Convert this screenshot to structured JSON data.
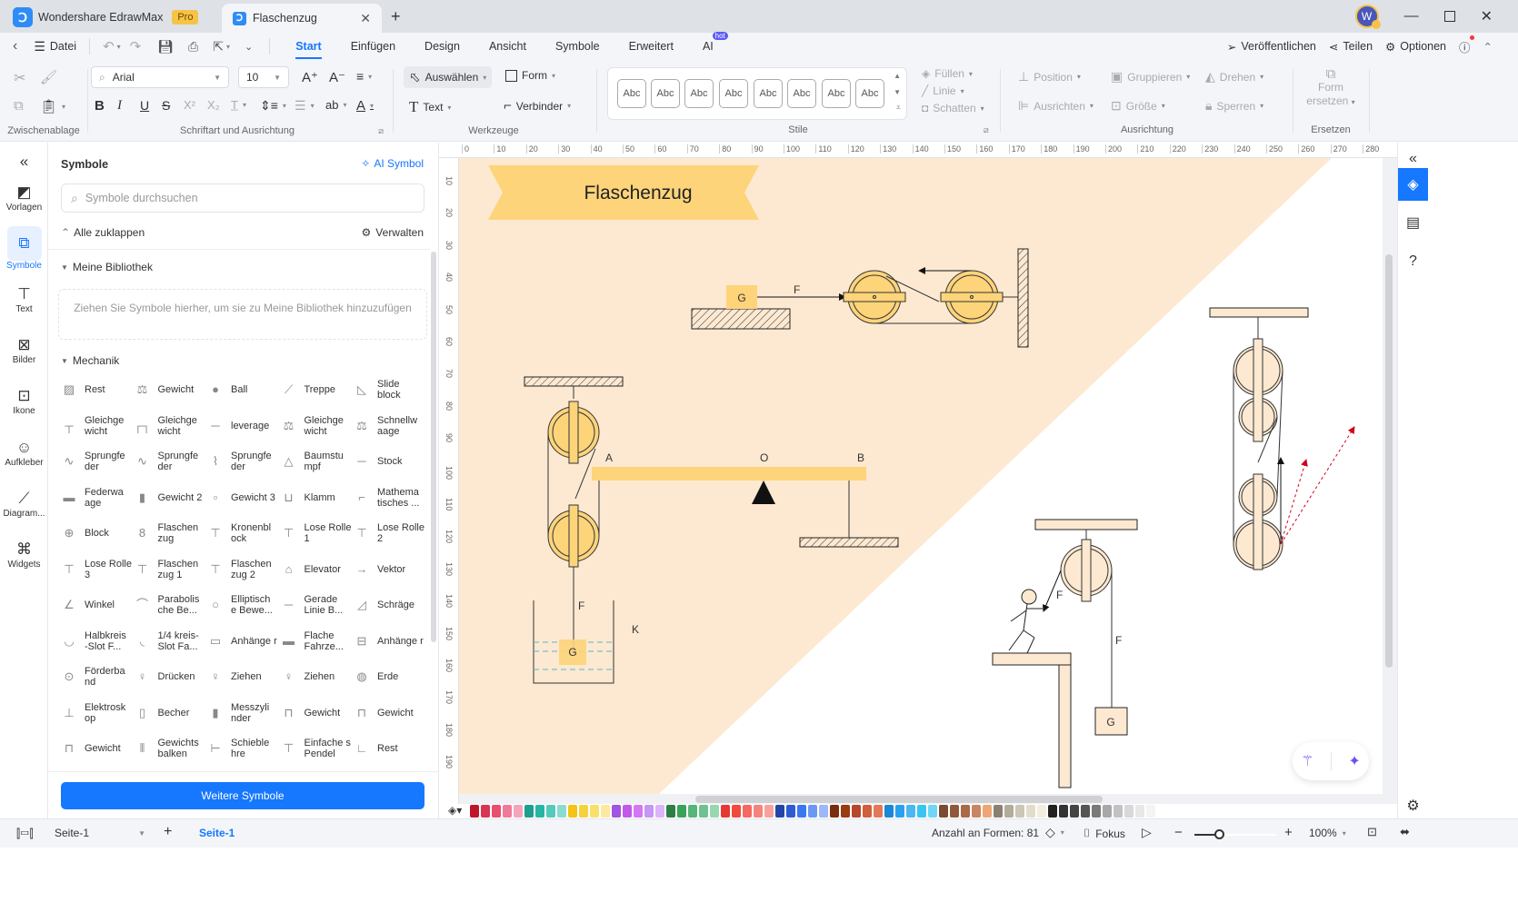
{
  "app": {
    "name": "Wondershare EdrawMax",
    "badge": "Pro",
    "doc_tab": "Flaschenzug",
    "avatar_initial": "W"
  },
  "menubar": {
    "file": "Datei",
    "tabs": [
      {
        "label": "Start",
        "active": true
      },
      {
        "label": "Einfügen"
      },
      {
        "label": "Design"
      },
      {
        "label": "Ansicht"
      },
      {
        "label": "Symbole"
      },
      {
        "label": "Erweitert"
      },
      {
        "label": "AI",
        "badge": "hot"
      }
    ],
    "right": {
      "publish": "Veröffentlichen",
      "share": "Teilen",
      "options": "Optionen"
    }
  },
  "ribbon": {
    "clipboard": {
      "label": "Zwischenablage"
    },
    "font": {
      "label": "Schriftart und Ausrichtung",
      "family": "Arial",
      "size": "10"
    },
    "tools": {
      "label": "Werkzeuge",
      "select": "Auswählen",
      "shape": "Form",
      "text": "Text",
      "connector": "Verbinder"
    },
    "styles": {
      "label": "Stile",
      "items": [
        "Abc",
        "Abc",
        "Abc",
        "Abc",
        "Abc",
        "Abc",
        "Abc",
        "Abc"
      ],
      "fill": "Füllen",
      "line": "Linie",
      "shadow": "Schatten"
    },
    "arrange": {
      "label": "Ausrichtung",
      "position": "Position",
      "group": "Gruppieren",
      "rotate": "Drehen",
      "align": "Ausrichten",
      "size": "Größe",
      "lock": "Sperren"
    },
    "replace": {
      "label": "Ersetzen",
      "button_line1": "Form",
      "button_line2": "ersetzen"
    }
  },
  "left_rail": [
    {
      "label": "Vorlagen",
      "icon": "template-icon"
    },
    {
      "label": "Symbole",
      "icon": "symbols-icon",
      "active": true
    },
    {
      "label": "Text",
      "icon": "text-icon"
    },
    {
      "label": "Bilder",
      "icon": "image-icon"
    },
    {
      "label": "Ikone",
      "icon": "icon-icon"
    },
    {
      "label": "Aufkleber",
      "icon": "sticker-icon"
    },
    {
      "label": "Diagram...",
      "icon": "chart-icon"
    },
    {
      "label": "Widgets",
      "icon": "widgets-icon"
    }
  ],
  "panel": {
    "title": "Symbole",
    "ai_symbol": "AI Symbol",
    "search_placeholder": "Symbole durchsuchen",
    "collapse_all": "Alle zuklappen",
    "manage": "Verwalten",
    "my_library": "Meine Bibliothek",
    "dropzone": "Ziehen Sie Symbole hierher, um sie zu Meine Bibliothek hinzuzufügen",
    "section": "Mechanik",
    "symbols": [
      "Rest",
      "Gewicht",
      "Ball",
      "Treppe",
      "Slide block",
      "Gleichge wicht",
      "Gleichge wicht",
      "leverage",
      "Gleichge wicht",
      "Schnellw aage",
      "Sprungfe der",
      "Sprungfe der",
      "Sprungfe der",
      "Baumstu mpf",
      "Stock",
      "Federwa age",
      "Gewicht 2",
      "Gewicht 3",
      "Klamm",
      "Mathema tisches ...",
      "Block",
      "Flaschen zug",
      "Kronenbl ock",
      "Lose Rolle 1",
      "Lose Rolle 2",
      "Lose Rolle 3",
      "Flaschen zug 1",
      "Flaschen zug 2",
      "Elevator",
      "Vektor",
      "Winkel",
      "Parabolis che Be...",
      "Elliptisch e Bewe...",
      "Gerade Linie B...",
      "Schräge",
      "Halbkreis -Slot F...",
      "1/4 kreis- Slot Fa...",
      "Anhänge r",
      "Flache Fahrze...",
      "Anhänge r",
      "Förderba nd",
      "Drücken",
      "Ziehen",
      "Ziehen",
      "Erde",
      "Elektrosk op",
      "Becher",
      "Messzyli nder",
      "Gewicht",
      "Gewicht",
      "Gewicht",
      "Gewichts balken",
      "Schieble hre",
      "Einfache s Pendel",
      "Rest"
    ],
    "symbol_icons": [
      "▨",
      "⚖",
      "●",
      "⟋",
      "◺",
      "┬",
      "┌┐",
      "─",
      "⚖",
      "⚖",
      "∿",
      "∿",
      "⌇",
      "△",
      "─",
      "▬",
      "▮",
      "▫",
      "⊔",
      "⌐",
      "⊕",
      "8",
      "⊤",
      "⊤",
      "⊤",
      "⊤",
      "⊤",
      "⊤",
      "⌂",
      "→",
      "∠",
      "⌒",
      "○",
      "─",
      "◿",
      "◡",
      "◟",
      "▭",
      "▬",
      "⊟",
      "⊙",
      "♀",
      "♀",
      "♀",
      "◍",
      "⊥",
      "▯",
      "▮",
      "⊓",
      "⊓",
      "⊓",
      "⫴",
      "⊢",
      "⊤",
      "∟"
    ],
    "more_button": "Weitere Symbole"
  },
  "ruler": {
    "h_ticks": [
      "0",
      "10",
      "20",
      "30",
      "40",
      "50",
      "60",
      "70",
      "80",
      "90",
      "100",
      "110",
      "120",
      "130",
      "140",
      "150",
      "160",
      "170",
      "180",
      "190",
      "200",
      "210",
      "220",
      "230",
      "240",
      "250",
      "260",
      "270",
      "280"
    ],
    "v_ticks": [
      "10",
      "20",
      "30",
      "40",
      "50",
      "60",
      "70",
      "80",
      "90",
      "100",
      "110",
      "120",
      "130",
      "140",
      "150",
      "160",
      "170",
      "180",
      "190"
    ]
  },
  "diagram": {
    "title": "Flaschenzug",
    "labels": {
      "G": "G",
      "F": "F",
      "A": "A",
      "O": "O",
      "B": "B",
      "K": "K"
    },
    "colors": {
      "background_band": "#fde9d1",
      "title_banner": "#fdd47a",
      "pulley_fill": "#fdd47a",
      "pulley_light": "#fde9d1",
      "lever": "#fdd47a",
      "red_arrow": "#d0021b"
    }
  },
  "palette": [
    "#c0162c",
    "#d63553",
    "#e84f6f",
    "#f07a9a",
    "#f5a4bd",
    "#1e9e8e",
    "#28b5a3",
    "#55c9bb",
    "#8adbd0",
    "#f3c317",
    "#f6d23d",
    "#f8e06b",
    "#fbe9a0",
    "#a056e0",
    "#c15ae8",
    "#d477f2",
    "#c596f5",
    "#dcb4f8",
    "#2d7f45",
    "#3aa35a",
    "#55b57a",
    "#6fc191",
    "#98d8b0",
    "#e53935",
    "#f04c3e",
    "#f36a62",
    "#f5847f",
    "#f7a19c",
    "#2345a8",
    "#2f5bd4",
    "#3a78f2",
    "#6c98f5",
    "#9cb8f6",
    "#7a2d0c",
    "#9c3a10",
    "#b5472a",
    "#cf5f3d",
    "#e07a5a",
    "#1a88d6",
    "#2aa0ef",
    "#4cb6f2",
    "#3ac5f0",
    "#6fd6f5",
    "#7a4b33",
    "#8f5a3c",
    "#a9694a",
    "#c98662",
    "#eea677",
    "#8b8172",
    "#b2ac9c",
    "#cbc6b6",
    "#e2dccb",
    "#f1eddf",
    "#222222",
    "#333333",
    "#444444",
    "#555555",
    "#7a7a7a",
    "#a8a8a8",
    "#c2c2c2",
    "#d8d8d8",
    "#e8e8e8",
    "#f4f4f4"
  ],
  "statusbar": {
    "page_select": "Seite-1",
    "page_tab": "Seite-1",
    "shape_count": "Anzahl an Formen: 81",
    "focus": "Fokus",
    "zoom": "100%",
    "zoom_fraction": 0.3
  }
}
